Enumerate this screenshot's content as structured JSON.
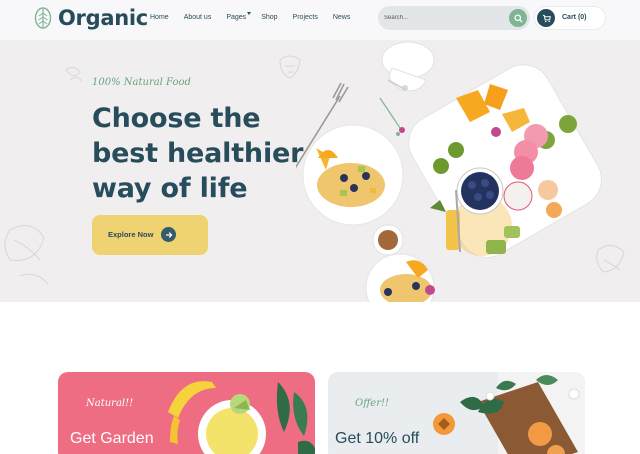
{
  "brand": {
    "name": "Organic"
  },
  "nav": {
    "items": [
      {
        "label": "Home"
      },
      {
        "label": "About us"
      },
      {
        "label": "Pages",
        "has_dropdown": true
      },
      {
        "label": "Shop"
      },
      {
        "label": "Projects"
      },
      {
        "label": "News"
      }
    ]
  },
  "search": {
    "placeholder": "Search..."
  },
  "cart": {
    "label": "Cart (0)"
  },
  "hero": {
    "tag": "100% Natural Food",
    "title": "Choose the best healthier way of life",
    "button_label": "Explore Now"
  },
  "offers": [
    {
      "tag": "Natural!!",
      "title": "Get Garden"
    },
    {
      "tag": "Offer!!",
      "title": "Get 10% off"
    }
  ],
  "colors": {
    "primary": "#274c5b",
    "accent_green": "#7eb693",
    "accent_yellow": "#efd372",
    "hero_bg": "#f1eeef",
    "card_pink": "#ee6d82",
    "card_grey": "#e9edef"
  },
  "icons": [
    "leaf-logo-icon",
    "search-icon",
    "cart-icon",
    "arrow-right-icon",
    "dropdown-caret-icon"
  ]
}
